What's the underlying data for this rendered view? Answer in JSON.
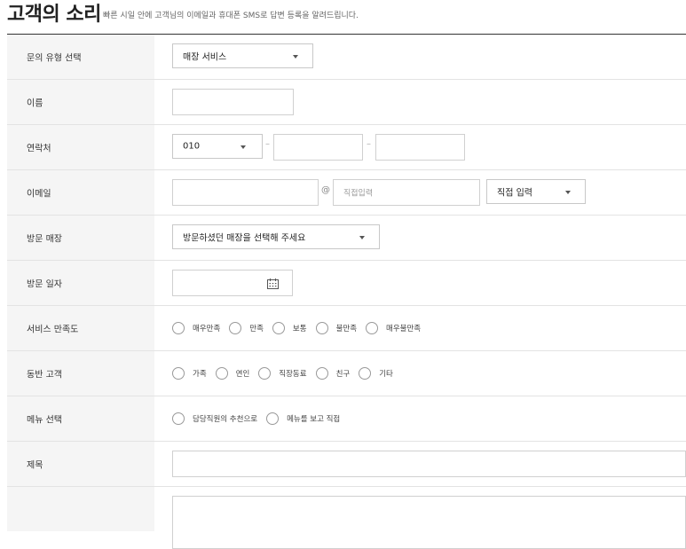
{
  "header": {
    "title": "고객의 소리",
    "subtitle": "빠른 시일 안에 고객님의 이메일과 휴대폰 SMS로 답변 등록을 알려드립니다."
  },
  "form": {
    "inquiry_type": {
      "label": "문의 유형 선택",
      "value": "매장 서비스"
    },
    "name": {
      "label": "이름",
      "value": ""
    },
    "contact": {
      "label": "연락처",
      "prefix": "010",
      "middle": "",
      "last": "",
      "dash": "–"
    },
    "email": {
      "label": "이메일",
      "local": "",
      "at": "@",
      "domain_placeholder": "직접입력",
      "domain_select": "직접 입력"
    },
    "visit_store": {
      "label": "방문 매장",
      "value": "방문하셨던 매장을 선택해 주세요"
    },
    "visit_date": {
      "label": "방문 일자",
      "value": ""
    },
    "satisfaction": {
      "label": "서비스 만족도",
      "options": [
        "매우만족",
        "만족",
        "보통",
        "불만족",
        "매우불만족"
      ]
    },
    "companion": {
      "label": "동반 고객",
      "options": [
        "가족",
        "연인",
        "직장동료",
        "친구",
        "기타"
      ]
    },
    "menu_choice": {
      "label": "메뉴 선택",
      "options": [
        "담당직원의 추천으로",
        "메뉴를 보고 직접"
      ]
    },
    "subject": {
      "label": "제목",
      "value": ""
    }
  }
}
